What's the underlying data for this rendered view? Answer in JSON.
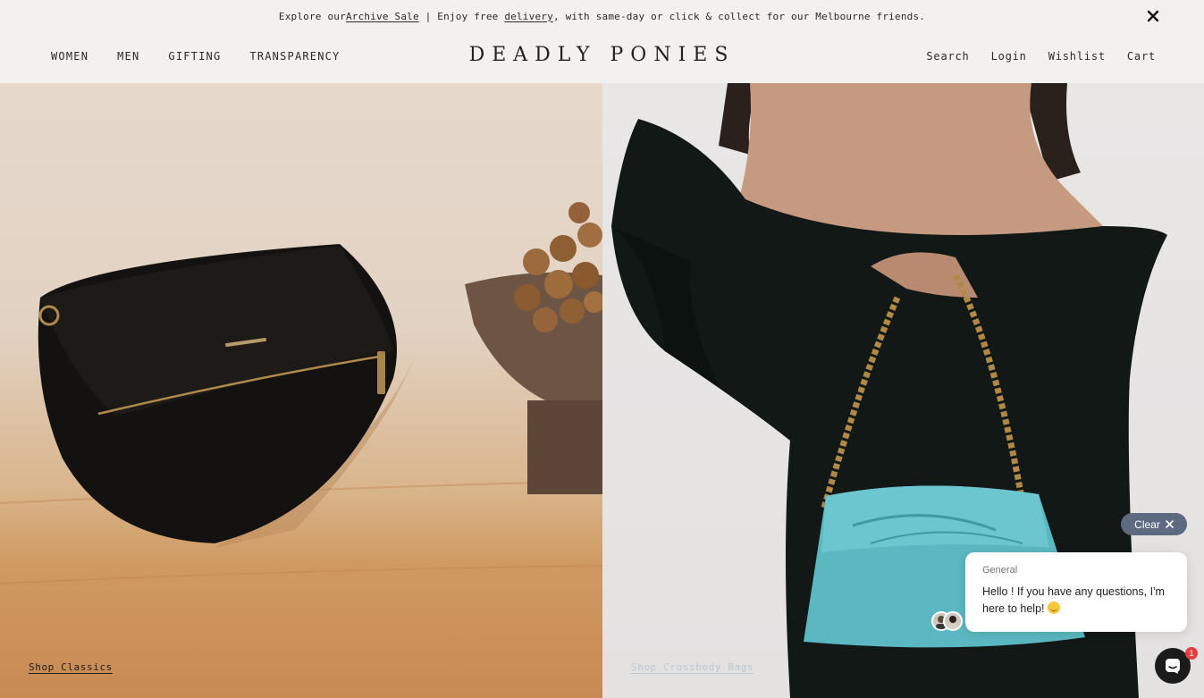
{
  "announcement": {
    "prefix": "Explore our ",
    "archive_link": "Archive Sale",
    "middle": " | Enjoy free ",
    "delivery_link": "delivery",
    "suffix": ", with same-day or click & collect for our Melbourne friends."
  },
  "header": {
    "logo": "DEADLY PONIES",
    "nav_left": [
      "WOMEN",
      "MEN",
      "GIFTING",
      "TRANSPARENCY"
    ],
    "nav_right": [
      "Search",
      "Login",
      "Wishlist",
      "Cart"
    ]
  },
  "hero": {
    "left_link": "Shop Classics",
    "right_link": "Shop Crossbody Bags"
  },
  "chat": {
    "clear_label": "Clear",
    "card_title": "General",
    "card_message": "Hello ! If you have any questions, I'm here to help!",
    "badge_count": "1"
  },
  "colors": {
    "background": "#f2f1ed",
    "chat_pill": "#5d6a80",
    "badge": "#e33d3d"
  }
}
